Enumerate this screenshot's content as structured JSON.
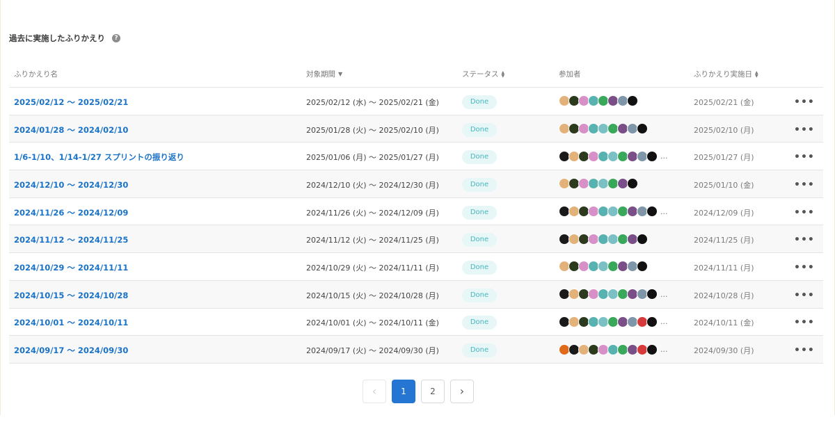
{
  "section": {
    "title": "過去に実施したふりかえり",
    "help_icon": "question-circle-icon"
  },
  "table": {
    "headers": {
      "name": "ふりかえり名",
      "period": "対象期間",
      "status": "ステータス",
      "participants": "参加者",
      "date": "ふりかえり実施日"
    },
    "rows": [
      {
        "name": "2025/02/12 〜 2025/02/21",
        "period": "2025/02/12 (水) 〜 2025/02/21 (金)",
        "status": "Done",
        "date": "2025/02/21 (金)",
        "avatars": [
          "#e3b27a",
          "#2c3a1e",
          "#d890c8",
          "#58b3b0",
          "#3aa85a",
          "#7a4f88",
          "#7e96a8",
          "#111111"
        ],
        "more": ""
      },
      {
        "name": "2024/01/28 〜 2024/02/10",
        "period": "2025/01/28 (火) 〜 2025/02/10 (月)",
        "status": "Done",
        "date": "2025/02/10 (月)",
        "avatars": [
          "#e3b27a",
          "#2c3a1e",
          "#d890c8",
          "#58b3b0",
          "#7ac0c4",
          "#3aa85a",
          "#7a4f88",
          "#7e96a8",
          "#111111"
        ],
        "more": ""
      },
      {
        "name": "1/6-1/10、1/14-1/27 スプリントの振り返り",
        "period": "2025/01/06 (月) 〜 2025/01/27 (月)",
        "status": "Done",
        "date": "2025/01/27 (月)",
        "avatars": [
          "#1a1a1a",
          "#e3b27a",
          "#2c3a1e",
          "#d890c8",
          "#58b3b0",
          "#7ac0c4",
          "#3aa85a",
          "#7a4f88",
          "#7e96a8",
          "#111111"
        ],
        "more": "..."
      },
      {
        "name": "2024/12/10 〜 2024/12/30",
        "period": "2024/12/10 (火) 〜 2024/12/30 (月)",
        "status": "Done",
        "date": "2025/01/10 (金)",
        "avatars": [
          "#e3b27a",
          "#2c3a1e",
          "#d890c8",
          "#58b3b0",
          "#7ac0c4",
          "#3aa85a",
          "#7a4f88",
          "#111111"
        ],
        "more": ""
      },
      {
        "name": "2024/11/26 〜 2024/12/09",
        "period": "2024/11/26 (火) 〜 2024/12/09 (月)",
        "status": "Done",
        "date": "2024/12/09 (月)",
        "avatars": [
          "#1a1a1a",
          "#e3b27a",
          "#2c3a1e",
          "#d890c8",
          "#58b3b0",
          "#7ac0c4",
          "#3aa85a",
          "#7a4f88",
          "#7e96a8",
          "#111111"
        ],
        "more": "..."
      },
      {
        "name": "2024/11/12 〜 2024/11/25",
        "period": "2024/11/12 (火) 〜 2024/11/25 (月)",
        "status": "Done",
        "date": "2024/11/25 (月)",
        "avatars": [
          "#1a1a1a",
          "#e3b27a",
          "#2c3a1e",
          "#d890c8",
          "#58b3b0",
          "#7ac0c4",
          "#3aa85a",
          "#7a4f88",
          "#111111"
        ],
        "more": ""
      },
      {
        "name": "2024/10/29 〜 2024/11/11",
        "period": "2024/10/29 (火) 〜 2024/11/11 (月)",
        "status": "Done",
        "date": "2024/11/11 (月)",
        "avatars": [
          "#e3b27a",
          "#2c3a1e",
          "#d890c8",
          "#58b3b0",
          "#7ac0c4",
          "#3aa85a",
          "#7a4f88",
          "#7e96a8",
          "#111111"
        ],
        "more": ""
      },
      {
        "name": "2024/10/15 〜 2024/10/28",
        "period": "2024/10/15 (火) 〜 2024/10/28 (月)",
        "status": "Done",
        "date": "2024/10/28 (月)",
        "avatars": [
          "#1a1a1a",
          "#e3b27a",
          "#2c3a1e",
          "#d890c8",
          "#58b3b0",
          "#7ac0c4",
          "#3aa85a",
          "#7a4f88",
          "#7e96a8",
          "#111111"
        ],
        "more": "..."
      },
      {
        "name": "2024/10/01 〜 2024/10/11",
        "period": "2024/10/01 (火) 〜 2024/10/11 (金)",
        "status": "Done",
        "date": "2024/10/11 (金)",
        "avatars": [
          "#1a1a1a",
          "#e3b27a",
          "#2c3a1e",
          "#58b3b0",
          "#7ac0c4",
          "#3aa85a",
          "#7a4f88",
          "#7e96a8",
          "#d63a3a",
          "#111111"
        ],
        "more": "..."
      },
      {
        "name": "2024/09/17 〜 2024/09/30",
        "period": "2024/09/17 (火) 〜 2024/09/30 (月)",
        "status": "Done",
        "date": "2024/09/30 (月)",
        "avatars": [
          "#e06a1a",
          "#1a1a1a",
          "#e3b27a",
          "#2c3a1e",
          "#d890c8",
          "#58b3b0",
          "#3aa85a",
          "#7a4f88",
          "#d63a3a",
          "#111111"
        ],
        "more": "..."
      }
    ]
  },
  "pagination": {
    "prev_icon": "chevron-left-icon",
    "next_icon": "chevron-right-icon",
    "pages": [
      "1",
      "2"
    ],
    "current": "1"
  },
  "colors": {
    "link": "#1a73c8",
    "status_bg": "#e7f6f7",
    "status_text": "#46b7be",
    "active_page": "#2476d2"
  }
}
